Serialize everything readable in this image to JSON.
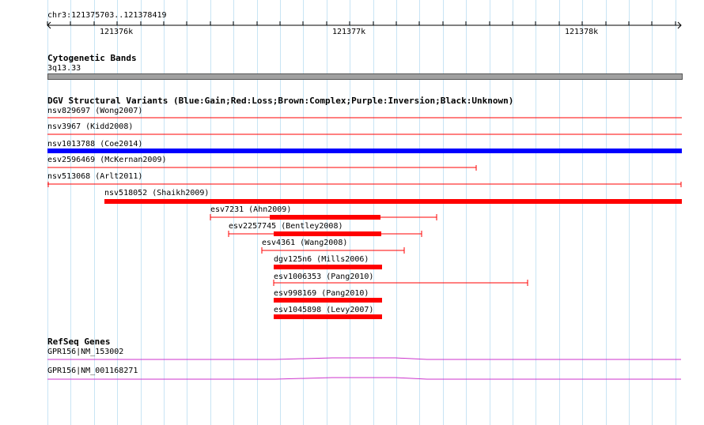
{
  "colors": {
    "grid": "#c8e4f4",
    "ruler": "#000000",
    "band": "#a0a0a0",
    "gain": "#0000ff",
    "loss": "#ff0000",
    "gene": "#cc33cc"
  },
  "ruler": {
    "region": "chr3:121375703..121378419",
    "ticks": [
      "121376k",
      "121377k",
      "121378k"
    ]
  },
  "cytoband": {
    "title": "Cytogenetic Bands",
    "band": "3q13.33"
  },
  "dgv": {
    "title": "DGV Structural Variants (Blue:Gain;Red:Loss;Brown:Complex;Purple:Inversion;Black:Unknown)",
    "variants": [
      {
        "label": "nsv829697 (Wong2007)",
        "type": "loss",
        "thick": false
      },
      {
        "label": "nsv3967 (Kidd2008)",
        "type": "loss",
        "thick": false
      },
      {
        "label": "nsv1013788 (Coe2014)",
        "type": "gain",
        "thick": true
      },
      {
        "label": "esv2596469 (McKernan2009)",
        "type": "loss",
        "thick": false
      },
      {
        "label": "nsv513068 (Arlt2011)",
        "type": "loss",
        "thick": false
      },
      {
        "label": "nsv518052 (Shaikh2009)",
        "type": "loss",
        "thick": true
      },
      {
        "label": "esv7231 (Ahn2009)",
        "type": "loss",
        "thick": false
      },
      {
        "label": "esv2257745 (Bentley2008)",
        "type": "loss",
        "thick": false
      },
      {
        "label": "esv4361 (Wang2008)",
        "type": "loss",
        "thick": false
      },
      {
        "label": "dgv125n6 (Mills2006)",
        "type": "loss",
        "thick": true
      },
      {
        "label": "esv1006353 (Pang2010)",
        "type": "loss",
        "thick": false
      },
      {
        "label": "esv998169 (Pang2010)",
        "type": "loss",
        "thick": true
      },
      {
        "label": "esv1045898 (Levy2007)",
        "type": "loss",
        "thick": true
      }
    ]
  },
  "refseq": {
    "title": "RefSeq Genes",
    "genes": [
      {
        "label": "GPR156|NM_153002"
      },
      {
        "label": "GPR156|NM_001168271"
      }
    ]
  }
}
